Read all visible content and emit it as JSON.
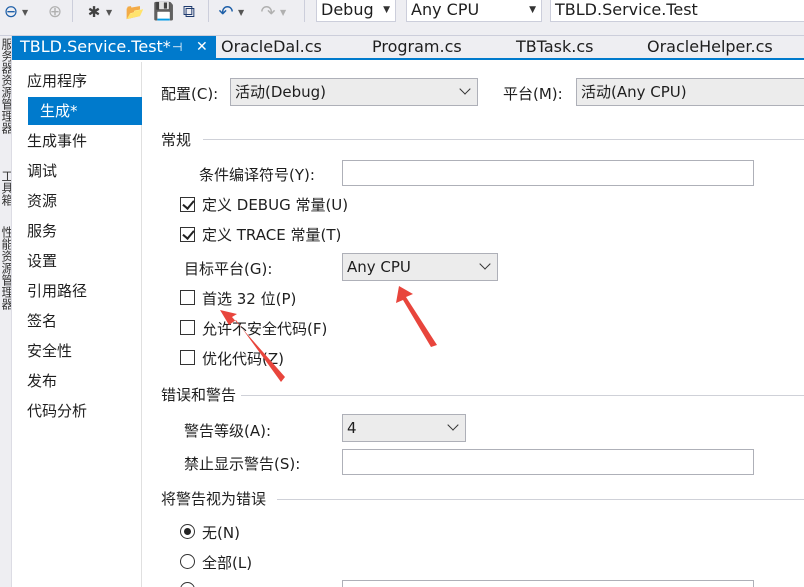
{
  "toolbar": {
    "config_combo": "Debug",
    "platform_combo": "Any CPU",
    "startup_combo": "TBLD.Service.Test"
  },
  "side_strip": {
    "items": [
      "服务器资源管理器",
      "工具箱",
      "性能资源管理器"
    ]
  },
  "tabs": [
    {
      "label": "TBLD.Service.Test*",
      "pin": "⊣",
      "close": "✕"
    },
    {
      "label": "OracleDal.cs"
    },
    {
      "label": "Program.cs"
    },
    {
      "label": "TBTask.cs"
    },
    {
      "label": "OracleHelper.cs"
    }
  ],
  "nav": {
    "items": [
      "应用程序",
      "生成*",
      "生成事件",
      "调试",
      "资源",
      "服务",
      "设置",
      "引用路径",
      "签名",
      "安全性",
      "发布",
      "代码分析"
    ]
  },
  "header": {
    "config_label": "配置(C):",
    "config_value": "活动(Debug)",
    "platform_label": "平台(M):",
    "platform_value": "活动(Any CPU)"
  },
  "general": {
    "title": "常规",
    "conditional_symbols_label": "条件编译符号(Y):",
    "conditional_symbols_value": "",
    "define_debug": "定义 DEBUG 常量(U)",
    "define_trace": "定义 TRACE 常量(T)",
    "platform_target_label": "目标平台(G):",
    "platform_target_value": "Any CPU",
    "prefer32": "首选 32 位(P)",
    "unsafe": "允许不安全代码(F)",
    "optimize": "优化代码(Z)"
  },
  "errors": {
    "title": "错误和警告",
    "warning_level_label": "警告等级(A):",
    "warning_level_value": "4",
    "suppress_label": "禁止显示警告(S):",
    "suppress_value": ""
  },
  "treat_warnings": {
    "title": "将警告视为错误",
    "none": "无(N)",
    "all": "全部(L)"
  },
  "colors": {
    "accent": "#007acc",
    "annotation_arrow": "#e8453c"
  }
}
